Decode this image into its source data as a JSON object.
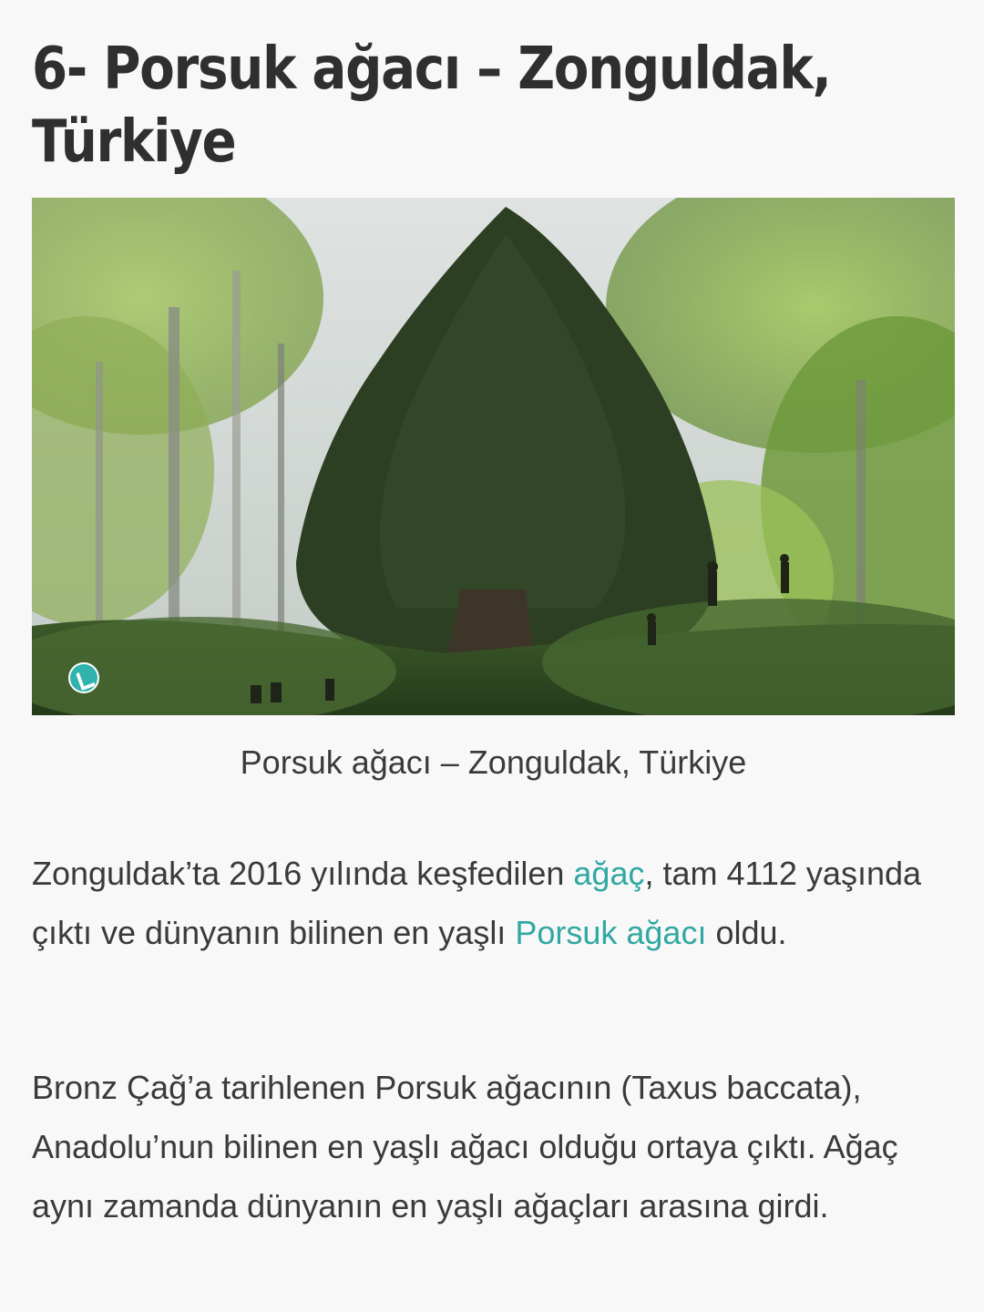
{
  "article": {
    "title": "6- Porsuk ağacı – Zonguldak, Türkiye",
    "figure": {
      "caption": "Porsuk ağacı – Zonguldak, Türkiye",
      "watermark_icon": "brand-logo-icon"
    },
    "paragraph1": {
      "text_before": "Zonguldak’ta 2016 yılında keşfedilen ",
      "link1": "ağaç",
      "text_middle": ", tam 4112 yaşında çıktı ve dünyanın bilinen en yaşlı ",
      "link2": "Porsuk ağacı",
      "text_after": " oldu."
    },
    "paragraph2": {
      "text": "Bronz Çağ’a tarihlenen Porsuk ağacının (Taxus baccata), Anadolu’nun bilinen en yaşlı ağacı olduğu ortaya çıktı. Ağaç aynı zamanda dünyanın en yaşlı ağaçları arasına girdi."
    }
  },
  "colors": {
    "background": "#f8f8f8",
    "text": "#3a3a3a",
    "link": "#31a8a3"
  }
}
